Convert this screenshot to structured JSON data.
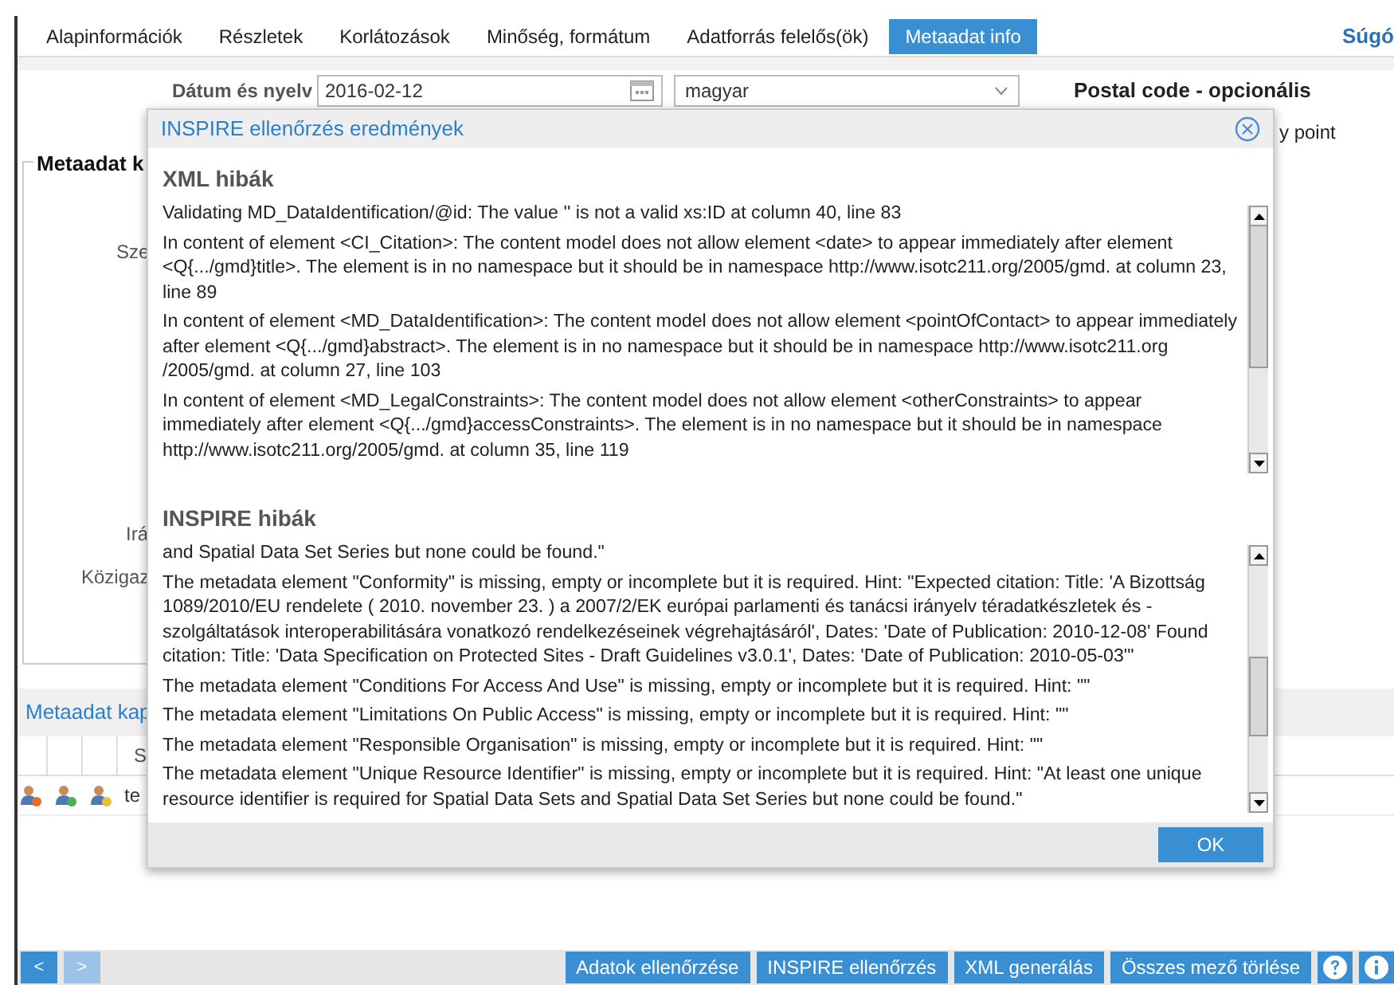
{
  "tabs": [
    {
      "label": "Alapinformációk",
      "selected": false
    },
    {
      "label": "Részletek",
      "selected": false
    },
    {
      "label": "Korlátozások",
      "selected": false
    },
    {
      "label": "Minőség, formátum",
      "selected": false
    },
    {
      "label": "Adatforrás felelős(ök)",
      "selected": false
    },
    {
      "label": "Metaadat info",
      "selected": true
    }
  ],
  "help_link": "Súgó",
  "form": {
    "date_label": "Dátum és nyelv",
    "date_value": "2016-02-12",
    "language_value": "magyar",
    "postal_code_label": "Postal code - opcionális",
    "side_text": "y point"
  },
  "fieldset": {
    "legend": "Metaadat k",
    "labels": [
      "Sze",
      "Irá",
      "Közigaz"
    ]
  },
  "contacts": {
    "title": "Metaadat kap",
    "column_header": "S",
    "row_text": "te"
  },
  "dialog": {
    "title": "INSPIRE ellenőrzés eredmények",
    "sections": [
      {
        "heading": "XML hibák",
        "messages": [
          "Validating MD_DataIdentification/@id: The value '' is not a valid xs:ID at column 40, line 83",
          "In content of element <CI_Citation>: The content model does not allow element <date> to appear immediately after element <Q{.../gmd}title>. The element is in no namespace but it should be in namespace http://www.isotc211.org/2005/gmd. at column 23, line 89",
          "In content of element <MD_DataIdentification>: The content model does not allow element <pointOfContact> to appear immediately after element <Q{.../gmd}abstract>. The element is in no namespace but it should be in namespace http://www.isotc211.org /2005/gmd. at column 27, line 103",
          "In content of element <MD_LegalConstraints>: The content model does not allow element <otherConstraints> to appear immediately after element <Q{.../gmd}accessConstraints>. The element is in no namespace but it should be in namespace http://www.isotc211.org/2005/gmd. at column 35, line 119"
        ]
      },
      {
        "heading": "INSPIRE hibák",
        "messages": [
          "and Spatial Data Set Series but none could be found.\"",
          "The metadata element \"Conformity\" is missing, empty or incomplete but it is required. Hint: \"Expected citation: Title: 'A Bizottság 1089/2010/EU rendelete ( 2010. november 23. ) a 2007/2/EK európai parlamenti és tanácsi irányelv téradatkészletek és -szolgáltatások interoperabilitására vonatkozó rendelkezéseinek végrehajtásáról', Dates: 'Date of Publication: 2010-12-08' Found citation: Title: 'Data Specification on Protected Sites - Draft Guidelines v3.0.1', Dates: 'Date of Publication: 2010-05-03'\"",
          "The metadata element \"Conditions For Access And Use\" is missing, empty or incomplete but it is required. Hint: \"\"",
          "The metadata element \"Limitations On Public Access\" is missing, empty or incomplete but it is required. Hint: \"\"",
          "The metadata element \"Responsible Organisation\" is missing, empty or incomplete but it is required. Hint: \"\"",
          "The metadata element \"Unique Resource Identifier\" is missing, empty or incomplete but it is required. Hint: \"At least one unique resource identifier is required for Spatial Data Sets and Spatial Data Set Series but none could be found.\""
        ]
      }
    ],
    "ok_button": "OK"
  },
  "nav_buttons": [
    {
      "label": "<",
      "disabled": false
    },
    {
      "label": ">",
      "disabled": true
    }
  ],
  "action_buttons": [
    "Adatok ellenőrzése",
    "INSPIRE ellenőrzés",
    "XML generálás",
    "Összes mező törlése"
  ]
}
